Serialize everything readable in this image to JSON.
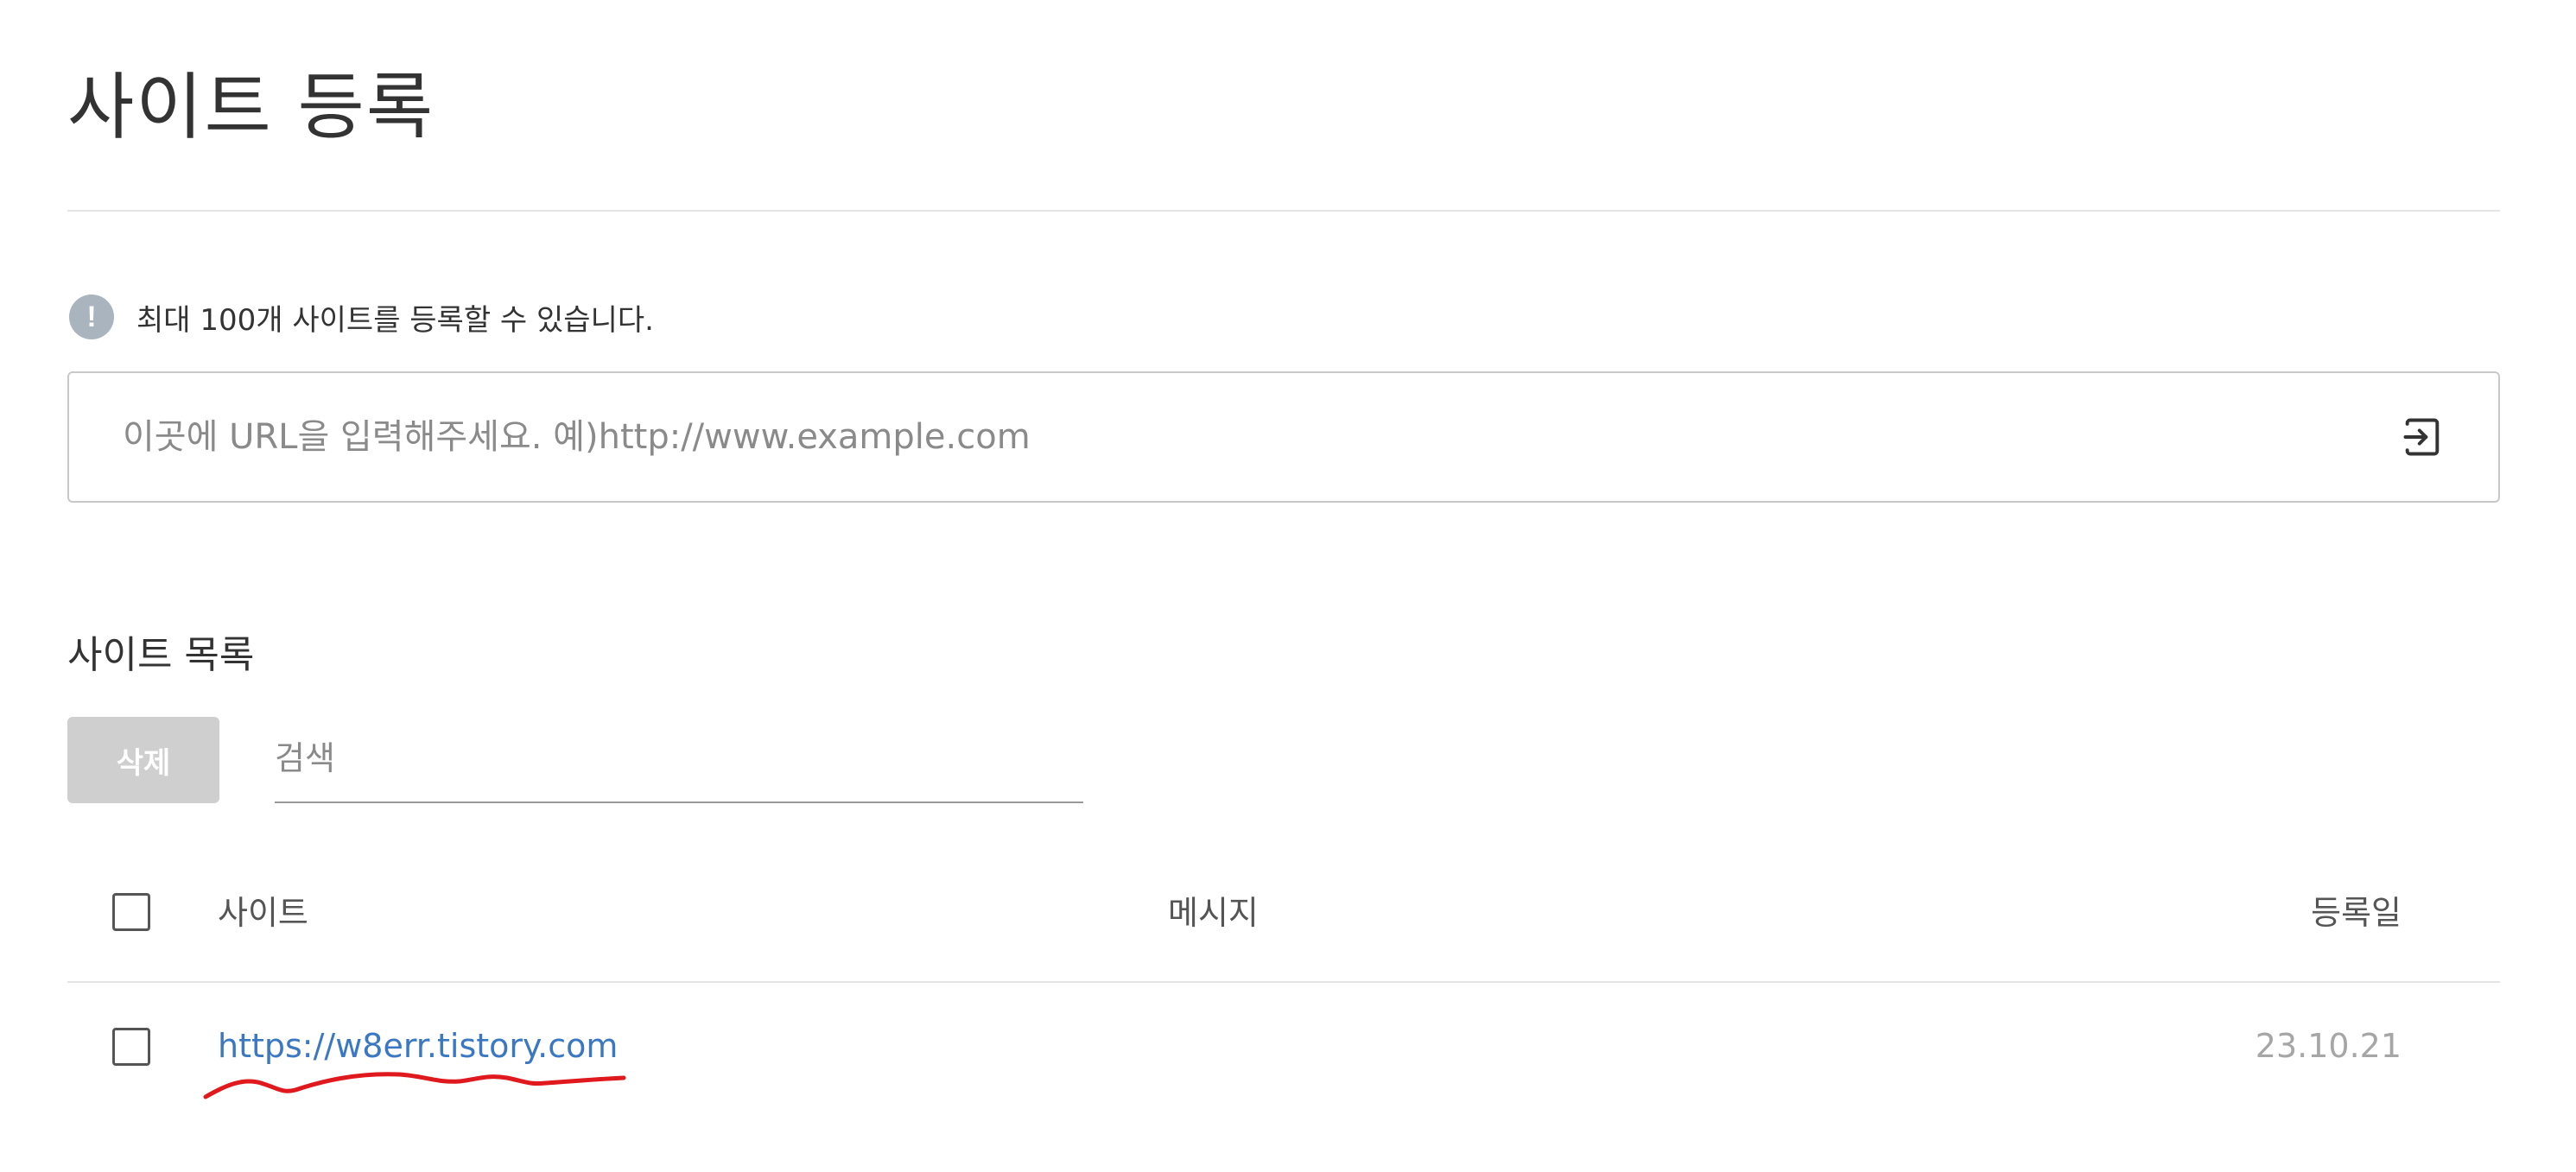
{
  "page": {
    "title": "사이트 등록"
  },
  "notice": {
    "icon": "exclamation-icon",
    "icon_glyph": "!",
    "text": "최대 100개 사이트를 등록할 수 있습니다."
  },
  "url_input": {
    "placeholder": "이곳에 URL을 입력해주세요. 예)http://www.example.com",
    "value": "",
    "submit_icon": "enter-icon"
  },
  "site_list": {
    "title": "사이트 목록",
    "delete_label": "삭제",
    "search_placeholder": "검색",
    "columns": {
      "site": "사이트",
      "message": "메시지",
      "date": "등록일"
    },
    "rows": [
      {
        "site": "https://w8err.tistory.com",
        "message": "",
        "date": "23.10.21",
        "checked": false
      }
    ]
  },
  "colors": {
    "link": "#3b78c3",
    "annotation": "#e0191e",
    "delete_button_disabled": "#cfcfcf",
    "notice_icon": "#a9b4be"
  }
}
